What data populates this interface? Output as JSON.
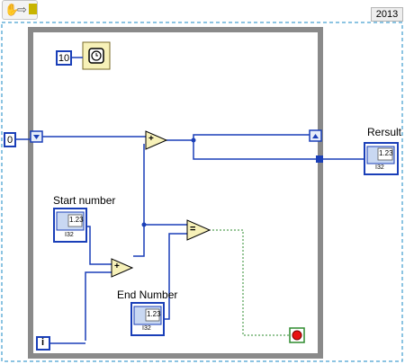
{
  "toolbar": {
    "icons": [
      "hand-icon",
      "arrow-right-icon",
      "run-icon"
    ]
  },
  "version_label": "2013",
  "constants": {
    "loop_count": "0",
    "wait_ms": "10"
  },
  "indicators": {
    "start_number": {
      "label": "Start number",
      "type_label": "I32",
      "display": "1.23"
    },
    "end_number": {
      "label": "End Number",
      "type_label": "I32",
      "display": "1.23"
    },
    "result": {
      "label": "Rersult",
      "type_label": "I32",
      "display": "1.23"
    }
  },
  "nodes": {
    "add_top": "+",
    "add_bottom": "+",
    "equal": "=",
    "iteration": "i"
  },
  "colors": {
    "wire_blue": "#1a3fb8",
    "loop_frame": "#8a8a8a",
    "stop_red": "#e81010",
    "bool_wire": "#2e8b2e"
  }
}
